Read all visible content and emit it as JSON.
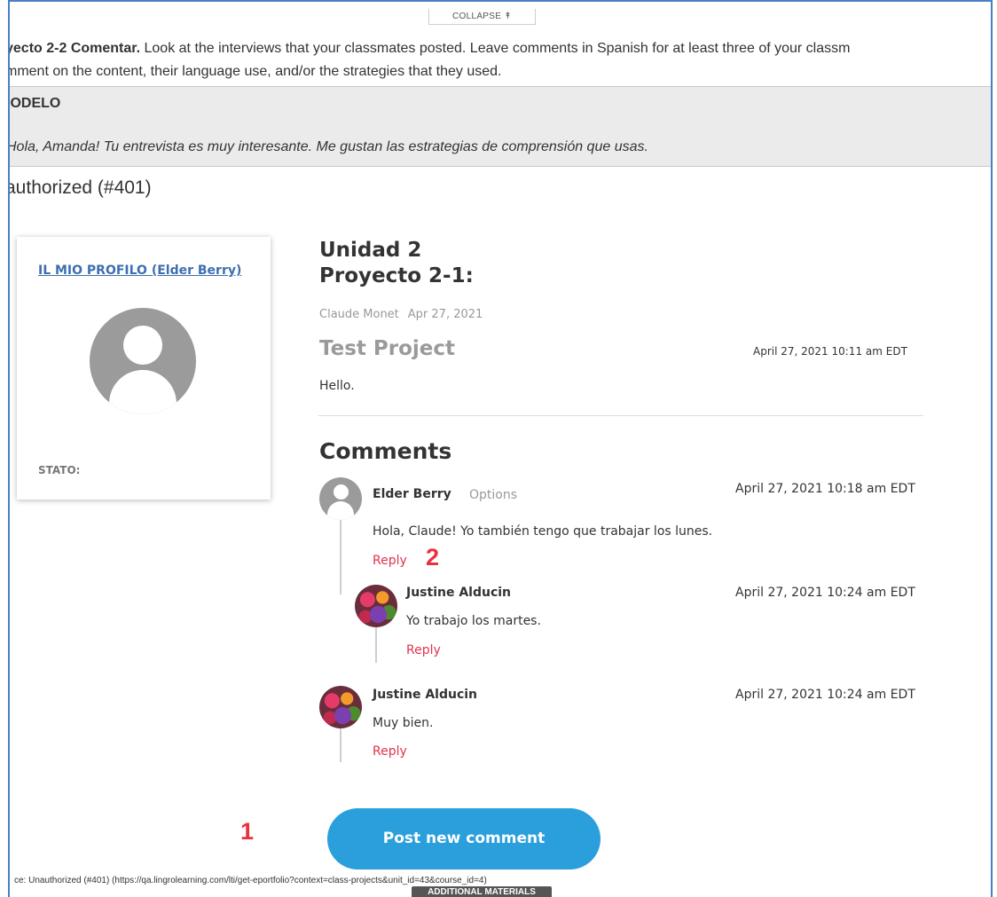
{
  "collapse": {
    "label": "COLLAPSE",
    "icon": "double-chevron-up-icon"
  },
  "instructions": {
    "bold": "yecto 2-2 Comentar.",
    "line1_rest": " Look at the interviews that your classmates posted. Leave comments in Spanish for at least three of your classm",
    "line2": "mment on the content, their language use, and/or the strategies that they used."
  },
  "modelo": {
    "title": "IODELO",
    "example": "Hola, Amanda! Tu entrevista es muy interesante. Me gustan las estrategias de comprensión que usas."
  },
  "error_heading": "authorized (#401)",
  "profile": {
    "link": "IL MIO PROFILO (Elder Berry)",
    "status_label": "STATO:",
    "avatar_icon": "user-placeholder-icon"
  },
  "project": {
    "unit_line1": "Unidad 2",
    "unit_line2": "Proyecto 2-1:",
    "author": "Claude Monet",
    "date": "Apr 27, 2021",
    "title": "Test Project",
    "timestamp": "April 27, 2021 10:11 am EDT",
    "body": "Hello."
  },
  "comments": {
    "heading": "Comments",
    "items": [
      {
        "author": "Elder Berry",
        "options": "Options",
        "timestamp": "April 27, 2021 10:18 am EDT",
        "text": "Hola, Claude!  Yo también tengo que trabajar los lunes.",
        "reply": "Reply",
        "replies": [
          {
            "author": "Justine Alducin",
            "timestamp": "April 27, 2021 10:24 am EDT",
            "text": "Yo trabajo los martes.",
            "reply": "Reply"
          }
        ]
      },
      {
        "author": "Justine Alducin",
        "timestamp": "April 27, 2021 10:24 am EDT",
        "text": "Muy bien.",
        "reply": "Reply"
      }
    ]
  },
  "post_button": "Post new comment",
  "markers": {
    "one": "1",
    "two": "2"
  },
  "footer_url": "ce: Unauthorized (#401) (https://qa.lingrolearning.com/lti/get-eportfolio?context=class-projects&unit_id=43&course_id=4)",
  "additional_materials": "ADDITIONAL MATERIALS",
  "colors": {
    "accent_blue": "#2a9fdc",
    "reply_red": "#e0334f",
    "link_blue": "#3d6fb0",
    "frame_blue": "#4a7fc1",
    "marker_red": "#e8323c"
  }
}
